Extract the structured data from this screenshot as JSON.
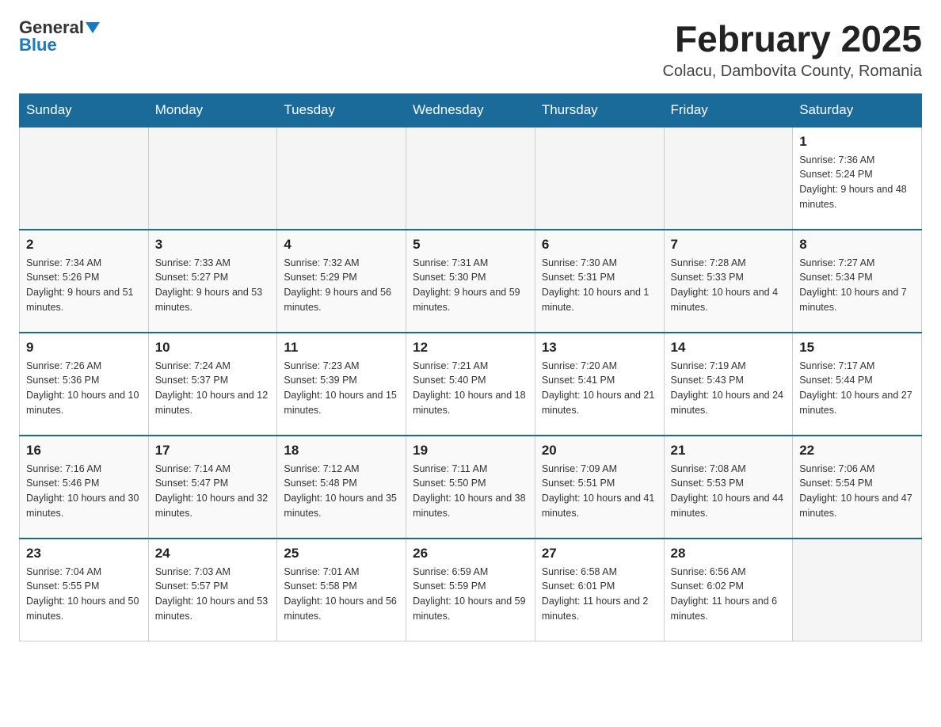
{
  "header": {
    "logo_general": "General",
    "logo_blue": "Blue",
    "month_title": "February 2025",
    "location": "Colacu, Dambovita County, Romania"
  },
  "weekdays": [
    "Sunday",
    "Monday",
    "Tuesday",
    "Wednesday",
    "Thursday",
    "Friday",
    "Saturday"
  ],
  "weeks": [
    [
      {
        "day": "",
        "info": ""
      },
      {
        "day": "",
        "info": ""
      },
      {
        "day": "",
        "info": ""
      },
      {
        "day": "",
        "info": ""
      },
      {
        "day": "",
        "info": ""
      },
      {
        "day": "",
        "info": ""
      },
      {
        "day": "1",
        "info": "Sunrise: 7:36 AM\nSunset: 5:24 PM\nDaylight: 9 hours and 48 minutes."
      }
    ],
    [
      {
        "day": "2",
        "info": "Sunrise: 7:34 AM\nSunset: 5:26 PM\nDaylight: 9 hours and 51 minutes."
      },
      {
        "day": "3",
        "info": "Sunrise: 7:33 AM\nSunset: 5:27 PM\nDaylight: 9 hours and 53 minutes."
      },
      {
        "day": "4",
        "info": "Sunrise: 7:32 AM\nSunset: 5:29 PM\nDaylight: 9 hours and 56 minutes."
      },
      {
        "day": "5",
        "info": "Sunrise: 7:31 AM\nSunset: 5:30 PM\nDaylight: 9 hours and 59 minutes."
      },
      {
        "day": "6",
        "info": "Sunrise: 7:30 AM\nSunset: 5:31 PM\nDaylight: 10 hours and 1 minute."
      },
      {
        "day": "7",
        "info": "Sunrise: 7:28 AM\nSunset: 5:33 PM\nDaylight: 10 hours and 4 minutes."
      },
      {
        "day": "8",
        "info": "Sunrise: 7:27 AM\nSunset: 5:34 PM\nDaylight: 10 hours and 7 minutes."
      }
    ],
    [
      {
        "day": "9",
        "info": "Sunrise: 7:26 AM\nSunset: 5:36 PM\nDaylight: 10 hours and 10 minutes."
      },
      {
        "day": "10",
        "info": "Sunrise: 7:24 AM\nSunset: 5:37 PM\nDaylight: 10 hours and 12 minutes."
      },
      {
        "day": "11",
        "info": "Sunrise: 7:23 AM\nSunset: 5:39 PM\nDaylight: 10 hours and 15 minutes."
      },
      {
        "day": "12",
        "info": "Sunrise: 7:21 AM\nSunset: 5:40 PM\nDaylight: 10 hours and 18 minutes."
      },
      {
        "day": "13",
        "info": "Sunrise: 7:20 AM\nSunset: 5:41 PM\nDaylight: 10 hours and 21 minutes."
      },
      {
        "day": "14",
        "info": "Sunrise: 7:19 AM\nSunset: 5:43 PM\nDaylight: 10 hours and 24 minutes."
      },
      {
        "day": "15",
        "info": "Sunrise: 7:17 AM\nSunset: 5:44 PM\nDaylight: 10 hours and 27 minutes."
      }
    ],
    [
      {
        "day": "16",
        "info": "Sunrise: 7:16 AM\nSunset: 5:46 PM\nDaylight: 10 hours and 30 minutes."
      },
      {
        "day": "17",
        "info": "Sunrise: 7:14 AM\nSunset: 5:47 PM\nDaylight: 10 hours and 32 minutes."
      },
      {
        "day": "18",
        "info": "Sunrise: 7:12 AM\nSunset: 5:48 PM\nDaylight: 10 hours and 35 minutes."
      },
      {
        "day": "19",
        "info": "Sunrise: 7:11 AM\nSunset: 5:50 PM\nDaylight: 10 hours and 38 minutes."
      },
      {
        "day": "20",
        "info": "Sunrise: 7:09 AM\nSunset: 5:51 PM\nDaylight: 10 hours and 41 minutes."
      },
      {
        "day": "21",
        "info": "Sunrise: 7:08 AM\nSunset: 5:53 PM\nDaylight: 10 hours and 44 minutes."
      },
      {
        "day": "22",
        "info": "Sunrise: 7:06 AM\nSunset: 5:54 PM\nDaylight: 10 hours and 47 minutes."
      }
    ],
    [
      {
        "day": "23",
        "info": "Sunrise: 7:04 AM\nSunset: 5:55 PM\nDaylight: 10 hours and 50 minutes."
      },
      {
        "day": "24",
        "info": "Sunrise: 7:03 AM\nSunset: 5:57 PM\nDaylight: 10 hours and 53 minutes."
      },
      {
        "day": "25",
        "info": "Sunrise: 7:01 AM\nSunset: 5:58 PM\nDaylight: 10 hours and 56 minutes."
      },
      {
        "day": "26",
        "info": "Sunrise: 6:59 AM\nSunset: 5:59 PM\nDaylight: 10 hours and 59 minutes."
      },
      {
        "day": "27",
        "info": "Sunrise: 6:58 AM\nSunset: 6:01 PM\nDaylight: 11 hours and 2 minutes."
      },
      {
        "day": "28",
        "info": "Sunrise: 6:56 AM\nSunset: 6:02 PM\nDaylight: 11 hours and 6 minutes."
      },
      {
        "day": "",
        "info": ""
      }
    ]
  ]
}
